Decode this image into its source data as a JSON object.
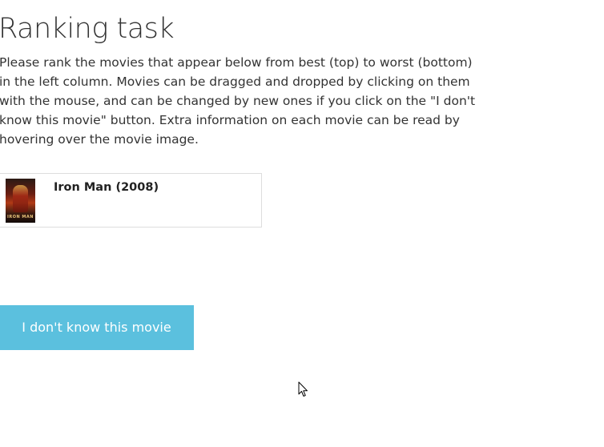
{
  "page": {
    "title": "Ranking task",
    "instructions": "Please rank the movies that appear below from best (top) to worst (bottom) in the left column. Movies can be dragged and dropped by clicking on them with the mouse, and can be changed by new ones if you click on the \"I don't know this movie\" button. Extra information on each movie can be read by hovering over the movie image."
  },
  "ranking_list": {
    "items": [
      {
        "title": "Iron Man (2008)",
        "poster_icon": "iron-man-poster",
        "poster_text": "IRON MAN"
      }
    ]
  },
  "actions": {
    "dont_know_label": "I don't know this movie",
    "button_color": "#5bc0de"
  }
}
